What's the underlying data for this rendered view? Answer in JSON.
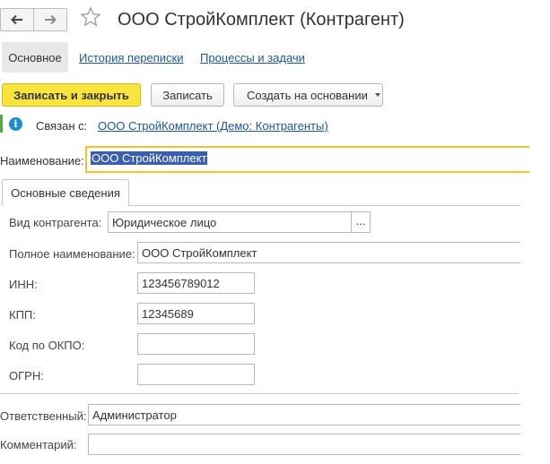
{
  "header": {
    "title": "ООО СтройКомплект (Контрагент)"
  },
  "nav": {
    "back_icon": "arrow-left-icon",
    "forward_icon": "arrow-right-icon",
    "favorite_icon": "star-outline-icon"
  },
  "section_tabs": {
    "main": "Основное",
    "correspondence": "История переписки",
    "processes": "Процессы и задачи"
  },
  "toolbar": {
    "save_close": "Записать и закрыть",
    "save": "Записать",
    "create_based_on": "Создать на основании"
  },
  "linked": {
    "label": "Связан с:",
    "link": "ООО СтройКомплект (Демо: Контрагенты)"
  },
  "name_field": {
    "label": "Наименование:",
    "value": "ООО СтройКомплект"
  },
  "inner_tabs": {
    "basic": "Основные сведения"
  },
  "form": {
    "kind_label": "Вид контрагента:",
    "kind_value": "Юридическое лицо",
    "kind_select_button": "...",
    "full_name_label": "Полное наименование:",
    "full_name_value": "ООО СтройКомплект",
    "inn_label": "ИНН:",
    "inn_value": "123456789012",
    "kpp_label": "КПП:",
    "kpp_value": "12345689",
    "okpo_label": "Код по ОКПО:",
    "okpo_value": "",
    "ogrn_label": "ОГРН:",
    "ogrn_value": "",
    "responsible_label": "Ответственный:",
    "responsible_value": "Администратор",
    "comment_label": "Комментарий:",
    "comment_value": ""
  },
  "colors": {
    "primary_button": "#f8e43d",
    "link": "#1a57a7",
    "focus_border": "#f2c12e",
    "selection": "#3a5fb0",
    "linked_marker": "#5aa64a",
    "info_icon": "#1e8cc9"
  }
}
